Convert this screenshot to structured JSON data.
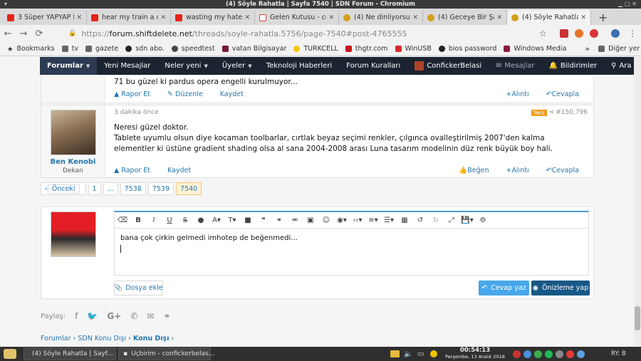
{
  "window": {
    "title": "(4) Söyle Rahatla | Sayfa 7540 | SDN Forum - Chromium"
  },
  "tabs": [
    {
      "label": "3 Süper YAPYAP E",
      "color": "#e62117"
    },
    {
      "label": "hear my train a co",
      "color": "#e62117"
    },
    {
      "label": "wasting my hate -",
      "color": "#e62117"
    },
    {
      "label": "Gelen Kutusu - co",
      "color": "#d44638"
    },
    {
      "label": "(4) Ne dinliyorsunu",
      "color": "#d4a017"
    },
    {
      "label": "(4) Geceye Bir Şa",
      "color": "#d4a017"
    },
    {
      "label": "(4) Söyle Rahatla",
      "color": "#d4a017"
    }
  ],
  "address": {
    "scheme": "https://",
    "host": "forum.shiftdelete.net",
    "path": "/threads/soyle-rahatla.5756/page-7540#post-4765555"
  },
  "bookmarks": [
    {
      "label": "Bookmarks",
      "icon": "star-icon"
    },
    {
      "label": "tv",
      "icon": "folder-icon"
    },
    {
      "label": "gazete",
      "icon": "folder-icon"
    },
    {
      "label": "sdn abo.",
      "icon": "sdn-icon"
    },
    {
      "label": "speedtest",
      "icon": "gauge-icon"
    },
    {
      "label": "vatan Bilgisayar",
      "icon": "vatan-icon"
    },
    {
      "label": "TURKCELL",
      "icon": "turkcell-icon"
    },
    {
      "label": "thgtr.com",
      "icon": "thg-icon"
    },
    {
      "label": "WinUSB",
      "icon": "winusb-icon"
    },
    {
      "label": "bios password",
      "icon": "bios-icon"
    },
    {
      "label": "Windows Media",
      "icon": "media-icon"
    }
  ],
  "bookmarks_overflow": "»",
  "bookmarks_other": "Diğer yer işaretleri",
  "forumnav": {
    "items": [
      "Forumlar",
      "Yeni Mesajlar",
      "Neler yeni",
      "Üyeler",
      "Teknoloji Haberleri",
      "Forum Kuralları"
    ],
    "user": "ConfickerBelasi",
    "messages": "Mesajlar",
    "alerts": "Bildirimler",
    "search": "Ara"
  },
  "post_prev": {
    "text": "71 bu güzel ki pardus opera engelli kurulmuyor...",
    "actions": [
      "Rapor Et",
      "Düzenle",
      "Kaydet"
    ],
    "right_actions": [
      "Alıntı",
      "Cevapla"
    ]
  },
  "post": {
    "author": "Ben Kenobi",
    "role": "Dekan",
    "time": "3 dakika önce",
    "new_badge": "Yeni",
    "number": "#150,796",
    "line1": "Neresi güzel doktor.",
    "line2": "Tablete uyumlu olsun diye kocaman toolbarlar, cırtlak beyaz seçimi renkler, çılgınca ovalleştirilmiş 2007'den kalma elementler ki üstüne gradient shading olsa al sana 2004-2008 arası Luna tasarım modelinin düz renk büyük boy hali.",
    "actions": [
      "Rapor Et",
      "Kaydet"
    ],
    "right_actions": [
      "Beğen",
      "Alıntı",
      "Cevapla"
    ]
  },
  "pager": {
    "prev": "Önceki",
    "pages": [
      "1",
      "...",
      "7538",
      "7539",
      "7540"
    ],
    "current": "7540"
  },
  "editor": {
    "text": "bana çok çirkin gelmedi imhotep de beğenmedi...",
    "attach": "Dosya ekle",
    "reply": "Cevap yaz",
    "preview": "Önizleme yap"
  },
  "share": {
    "label": "Paylaş:"
  },
  "breadcrumbs": [
    "Forumlar",
    "SDN Konu Dışı",
    "Konu Dışı"
  ],
  "taskbar": {
    "tasks": [
      "(4) Söyle Rahatla | Sayf...",
      "Uçbirim - confickerbelas..."
    ],
    "time": "00:54:13",
    "date": "Perşembe, 13 Aralık 2018",
    "lang": "RY: B"
  },
  "colors": {
    "accent": "#2577b1",
    "nav": "#1c2331",
    "reply_btn": "#47a7eb",
    "preview_btn": "#185886"
  }
}
